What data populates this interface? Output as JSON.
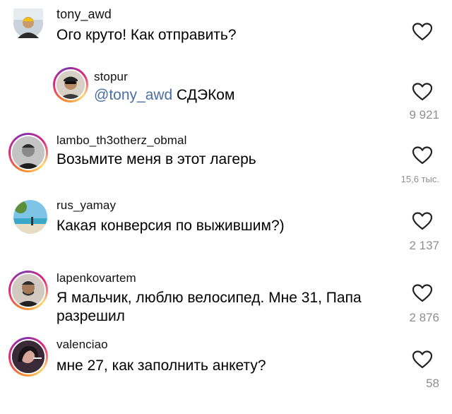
{
  "comments": [
    {
      "username": "tony_awd",
      "text": "Ого круто! Как отправить?",
      "likes": ""
    },
    {
      "username": "stopur",
      "mention": "@tony_awd",
      "text": " СДЭКом",
      "likes": "9 921"
    },
    {
      "username": "lambo_th3otherz_obmal",
      "text": "Возьмите меня в этот лагерь",
      "likes": "15,6 тыс."
    },
    {
      "username": "rus_yamay",
      "text": "Какая конверсия по выжившим?)",
      "likes": "2 137"
    },
    {
      "username": "lapenkovartem",
      "text": "Я мальчик, люблю велосипед. Мне 31, Папа разрешил",
      "likes": "2 876"
    },
    {
      "username": "valenciao",
      "text": "мне 27, как заполнить анкету?",
      "likes": "58"
    }
  ],
  "colors": {
    "text": "#000000",
    "username": "#111111",
    "mention": "#4a6fa5",
    "count": "#8e8e8e",
    "story_ring_start": "#f58529",
    "story_ring_mid": "#dd2a7b",
    "story_ring_end": "#8134af"
  },
  "icons": {
    "like": "heart-outline-icon"
  }
}
